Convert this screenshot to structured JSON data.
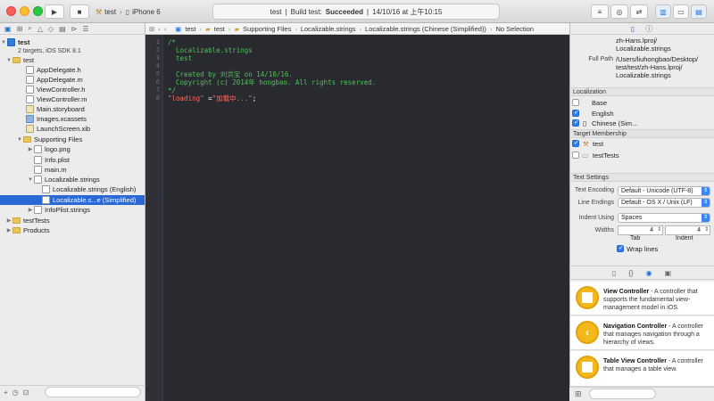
{
  "toolbar": {
    "scheme_target": "test",
    "scheme_device": "iPhone 6",
    "activity_project": "test",
    "activity_sep": "|",
    "activity_status_prefix": "Build test:",
    "activity_status": "Succeeded",
    "activity_sep2": "|",
    "activity_time": "14/10/16 at 上午10:15"
  },
  "navigator": {
    "project_name": "test",
    "project_sub": "2 targets, iOS SDK 8.1",
    "items": [
      {
        "label": "test"
      },
      {
        "label": "AppDelegate.h"
      },
      {
        "label": "AppDelegate.m"
      },
      {
        "label": "ViewController.h"
      },
      {
        "label": "ViewController.m"
      },
      {
        "label": "Main.storyboard"
      },
      {
        "label": "Images.xcassets"
      },
      {
        "label": "LaunchScreen.xib"
      },
      {
        "label": "Supporting Files"
      },
      {
        "label": "logo.png"
      },
      {
        "label": "Info.plist"
      },
      {
        "label": "main.m"
      },
      {
        "label": "Localizable.strings"
      },
      {
        "label": "Localizable.strings (English)"
      },
      {
        "label": "Localizable.s...e (Simplified)"
      },
      {
        "label": "InfoPlist.strings"
      },
      {
        "label": "testTests"
      },
      {
        "label": "Products"
      }
    ]
  },
  "jumpbar": {
    "segments": [
      "test",
      "test",
      "Supporting Files",
      "Localizable.strings",
      "Localizable.strings (Chinese (Simplified))",
      "No Selection"
    ]
  },
  "editor": {
    "line_numbers": [
      "1",
      "2",
      "3",
      "4",
      "5",
      "6",
      "7",
      "8"
    ],
    "lines": [
      "/*",
      "  Localizable.strings",
      "  test",
      "",
      "  Created by 刘洪宝 on 14/10/16.",
      "  Copyright (c) 2014年 hongbao. All rights reserved.",
      "*/"
    ],
    "line8_key": "\"loading\"",
    "line8_eq": " =",
    "line8_value": "\"加载中...\"",
    "line8_end": ";"
  },
  "inspector": {
    "path_top1": "zh-Hans.lproj/",
    "path_top2": "Localizable.strings",
    "full_path_label": "Full Path",
    "full_path1": "/Users/liuhongbao/Desktop/",
    "full_path2": "test/test/zh-Hans.lproj/",
    "full_path3": "Localizable.strings",
    "localization_header": "Localization",
    "localizations": [
      {
        "label": "Base",
        "checked": false
      },
      {
        "label": "English",
        "checked": true
      },
      {
        "label": "Chinese (Sim...",
        "checked": true
      }
    ],
    "target_header": "Target Membership",
    "targets": [
      {
        "label": "test",
        "checked": true
      },
      {
        "label": "testTests",
        "checked": false
      }
    ],
    "text_settings_header": "Text Settings",
    "text_encoding_label": "Text Encoding",
    "text_encoding_value": "Default - Unicode (UTF-8)",
    "line_endings_label": "Line Endings",
    "line_endings_value": "Default - OS X / Unix (LF)",
    "indent_using_label": "Indent Using",
    "indent_using_value": "Spaces",
    "widths_label": "Widths",
    "tab_value": "4",
    "tab_label": "Tab",
    "indent_value": "4",
    "indent_label": "Indent",
    "wrap_lines_label": "Wrap lines"
  },
  "library": {
    "items": [
      {
        "title": "View Controller",
        "desc": " - A controller that supports the fundamental view-management model in iOS."
      },
      {
        "title": "Navigation Controller",
        "desc": " - A controller that manages navigation through a hierarchy of views."
      },
      {
        "title": "Table View Controller",
        "desc": " - A controller that manages a table view."
      }
    ]
  }
}
